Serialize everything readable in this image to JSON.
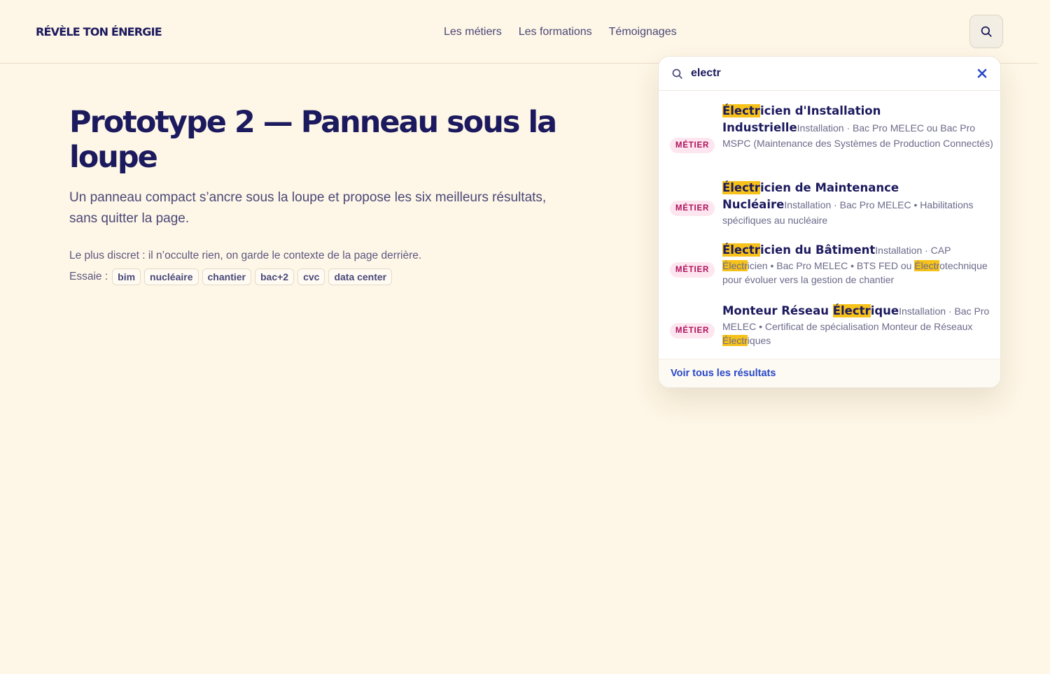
{
  "header": {
    "logo": "RÉVÈLE TON ÉNERGIE",
    "nav": [
      "Les métiers",
      "Les formations",
      "Témoignages"
    ]
  },
  "main": {
    "title": "Prototype 2 — Panneau sous la loupe",
    "subtitle": "Un panneau compact s’ancre sous la loupe et propose les six meilleurs résultats, sans quitter la page.",
    "note": "Le plus discret : il n’occulte rien, on garde le contexte de la page derrière.",
    "try_label": "Essaie :",
    "chips": [
      "bim",
      "nucléaire",
      "chantier",
      "bac+2",
      "cvc",
      "data center"
    ]
  },
  "search": {
    "query": "electr",
    "highlight_color": "#f6c21a",
    "results": [
      {
        "badge": "MÉTIER",
        "title_hl": "Électr",
        "title_rest": "icien d'Installation Industrielle",
        "meta_parts": [
          "Installation · Bac Pro MELEC ou Bac Pro MSPC (Maintenance des Systèmes de Production Connectés)"
        ]
      },
      {
        "badge": "MÉTIER",
        "title_hl": "Électr",
        "title_rest": "icien de Maintenance Nucléaire",
        "meta_parts": [
          "Installation · Bac Pro MELEC • Habilitations spécifiques au nucléaire"
        ]
      },
      {
        "badge": "MÉTIER",
        "title_hl": "Électr",
        "title_rest": "icien du Bâtiment",
        "meta_parts": [
          "Installation · CAP ",
          "Électr",
          "icien • Bac Pro MELEC • BTS FED ou ",
          "Électr",
          "otechnique pour évoluer vers la gestion de chantier"
        ]
      },
      {
        "badge": "MÉTIER",
        "title_pre": "Monteur Réseau ",
        "title_hl": "Électr",
        "title_rest": "ique",
        "meta_parts": [
          "Installation · Bac Pro MELEC • Certificat de spécialisation Monteur de Réseaux ",
          "Électr",
          "iques"
        ]
      }
    ],
    "see_all": "Voir tous les résultats"
  }
}
